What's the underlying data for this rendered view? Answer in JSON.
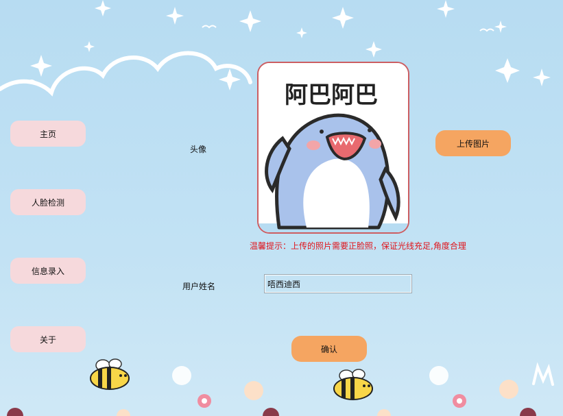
{
  "nav": {
    "home": "主页",
    "face_detect": "人脸检测",
    "info_entry": "信息录入",
    "about": "关于"
  },
  "form": {
    "avatar_label": "头像",
    "avatar_image_text": "阿巴阿巴",
    "upload_button": "上传图片",
    "hint": "温馨提示：上传的照片需要正脸照，保证光线充足,角度合理",
    "username_label": "用户姓名",
    "username_value": "唔西迪西",
    "confirm_button": "确认"
  },
  "colors": {
    "nav_button": "#f6d9dc",
    "action_button": "#f5a561",
    "hint_text": "#e0141b",
    "frame_border": "#cc5d61"
  }
}
